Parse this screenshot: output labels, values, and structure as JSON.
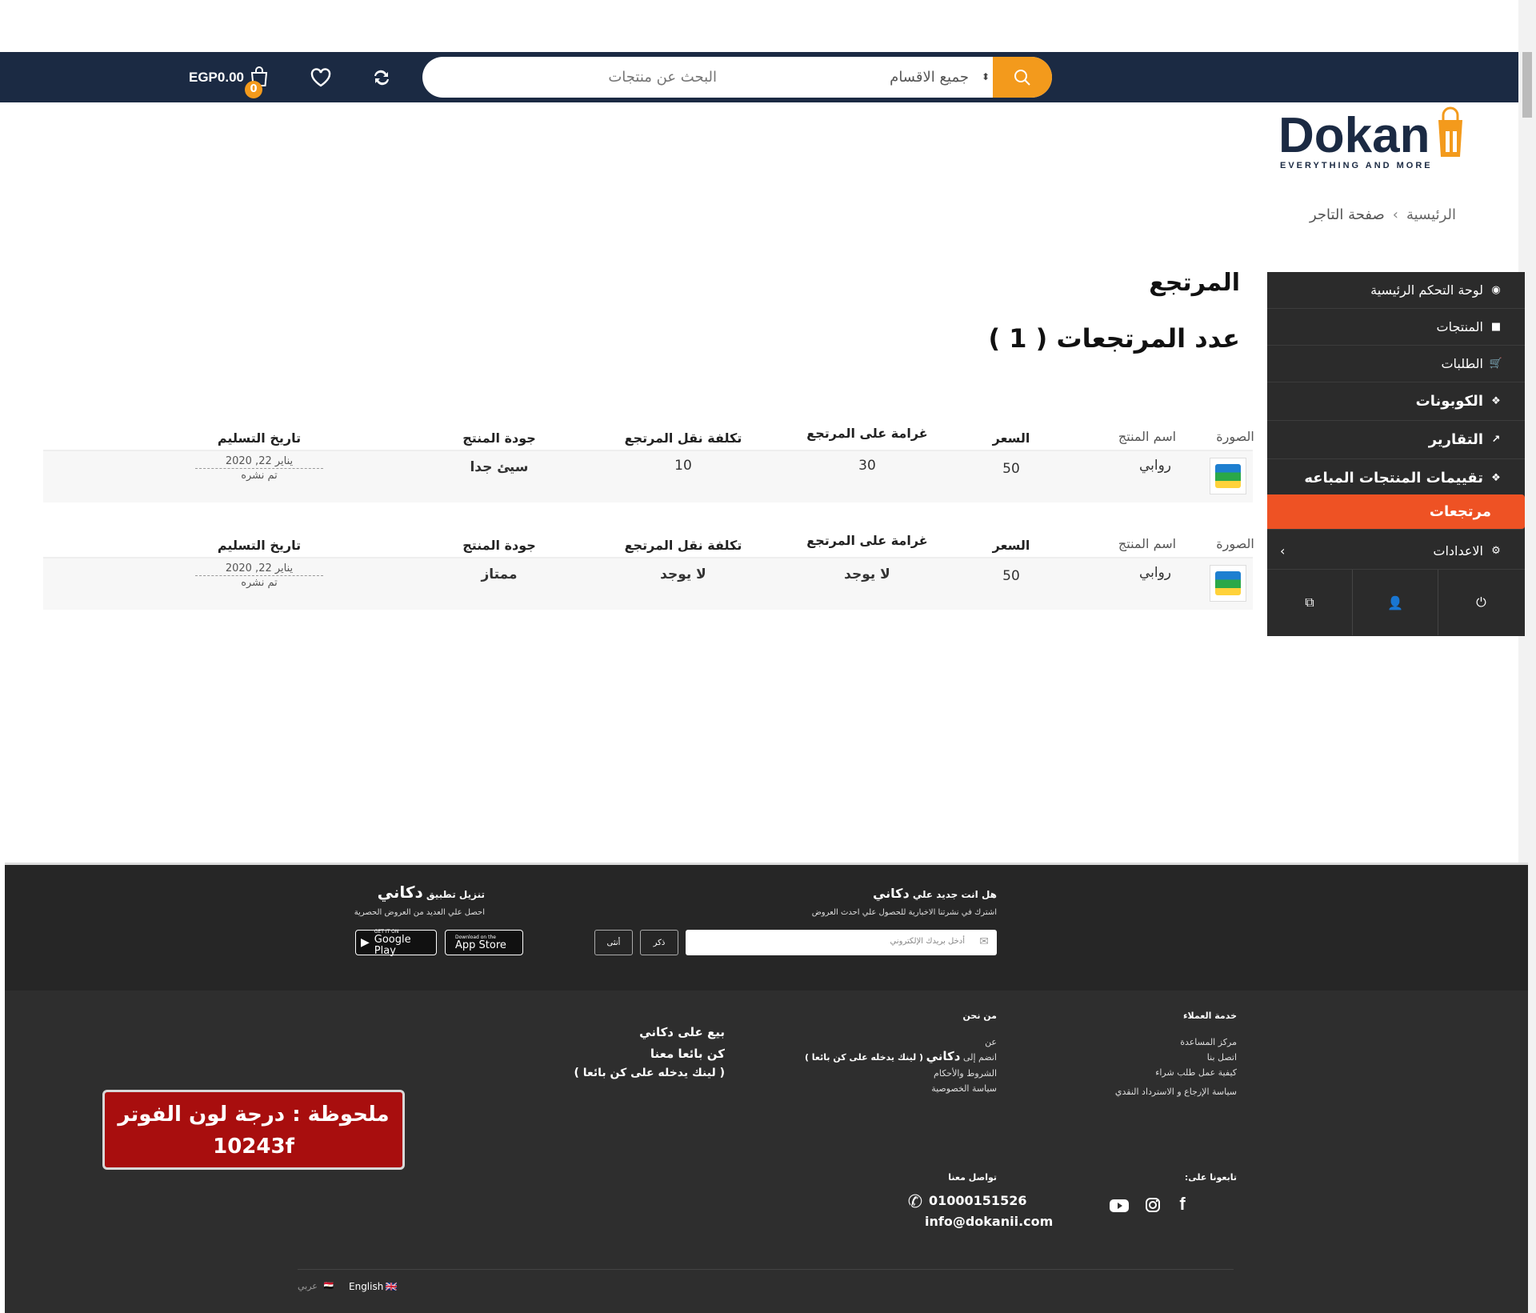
{
  "header": {
    "search_placeholder": "البحث عن منتجات",
    "category_select": "جميع الاقسام",
    "cart_total": "EGP0.00",
    "cart_count": "0",
    "brand_color": "#1b2a43",
    "accent_color": "#f39a1c"
  },
  "logo": {
    "name": "Dokanii",
    "tagline": "EVERYTHING AND MORE"
  },
  "breadcrumb": {
    "home": "الرئيسية",
    "current": "صفحة التاجر"
  },
  "sidebar": {
    "items": [
      {
        "label": "لوحة التحكم الرئيسية",
        "icon": "dashboard-icon"
      },
      {
        "label": "المنتجات",
        "icon": "briefcase-icon"
      },
      {
        "label": "الطلبات",
        "icon": "cart-icon"
      },
      {
        "label": "الكوبونات",
        "icon": "gift-icon"
      },
      {
        "label": "التقارير",
        "icon": "chart-icon"
      },
      {
        "label": "تقييمات المنتجات المباعه",
        "icon": "gift-icon"
      },
      {
        "label": "مرتجعات",
        "icon": ""
      },
      {
        "label": "الاعدادات",
        "icon": "gear-icon"
      }
    ],
    "active_color": "#ee5224"
  },
  "page": {
    "title": "المرتجع",
    "count_label": "عدد المرتجعات ( 1 )"
  },
  "table_headers": {
    "image": "الصورة",
    "name": "اسم المنتج",
    "price": "السعر",
    "fine": "غرامة على المرتجع",
    "shipping": "تكلفة نقل المرتجع",
    "quality": "جودة المنتج",
    "delivery": "تاريخ التسليم"
  },
  "returns": [
    {
      "name": "روابي",
      "price": "50",
      "fine": "30",
      "shipping": "10",
      "quality": "سيئ جدا",
      "date": "يناير 22, 2020",
      "status": "تم نشره"
    },
    {
      "name": "روابي",
      "price": "50",
      "fine": "لا يوجد",
      "shipping": "لا يوجد",
      "quality": "ممتاز",
      "date": "يناير 22, 2020",
      "status": "تم نشره"
    }
  ],
  "footer": {
    "newsletter_title": "هل انت جديد علي",
    "brand_ar": "دكاني",
    "newsletter_sub": "اشترك في نشرتنا الاخبارية للحصول علي احدث العروض",
    "email_placeholder": "أدخل بريدك الإلكتروني",
    "male": "ذكر",
    "female": "أنثى",
    "app_title": "تنزيل تطبيق",
    "app_sub": "احصل علي العديد من العروض الحصرية",
    "google_small": "GET IT ON",
    "google_big": "Google Play",
    "apple_small": "Download on the",
    "apple_big": "App Store",
    "customer_service": "خدمة العملاء",
    "cs_links": [
      "مركز المساعدة",
      "اتصل بنا",
      "كيفية عمل طلب شراء",
      "سياسة الإرجاع و الاسترداد النقدي"
    ],
    "about_title": "من نحن",
    "about_links": [
      "عن",
      "انضم إلى",
      "الشروط والأحكام",
      "سياسة الخصوصية"
    ],
    "about_join_note": "( لينك يدخله على كن بائعا )",
    "sell_title": "بيع على دكاني",
    "sell_link": "كن بائعا معنا",
    "sell_note": "( لينك يدخله على كن بائعا )",
    "follow_title": "تابعونا على:",
    "contact_title": "تواصل معنا",
    "phone": "01000151526",
    "email": "info@dokanii.com",
    "lang_en": "English",
    "lang_ar": "عربي",
    "bg_color": "#2e2e2e"
  },
  "annotation": {
    "line1": "ملحوظة : درجة لون الفوتر",
    "line2": "10243f"
  }
}
